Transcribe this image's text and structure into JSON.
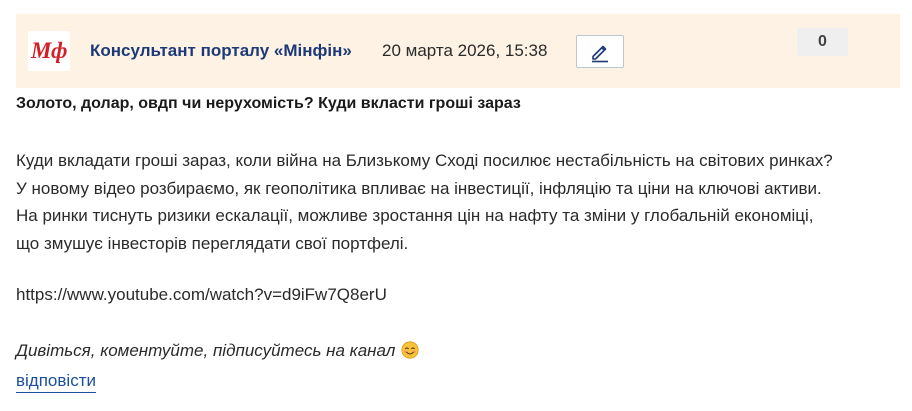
{
  "header": {
    "avatar_text": "Мф",
    "author": "Консультант порталу «Мінфін»",
    "date": "20 марта 2026, 15:38",
    "edit_icon": "pencil-icon",
    "rating": "0"
  },
  "post": {
    "title": "Золото, долар, овдп чи нерухомість? Куди вкласти гроші зараз",
    "body_lines": [
      "Куди вкладати гроші зараз, коли війна на Близькому Сході посилює нестабільність на світових ринках?",
      "У новому відео розбираємо, як геополітика впливає на інвестиції, інфляцію та ціни на ключові активи.",
      "На ринки тиснуть ризики ескалації, можливе зростання цін на нафту та зміни у глобальній економіці,",
      "що змушує інвесторів переглядати свої портфелі."
    ],
    "link": "https://www.youtube.com/watch?v=d9iFw7Q8erU",
    "outro": "Дивіться, коментуйте, підписуйтесь на канал",
    "outro_icon": "smiling-face-emoji-icon",
    "reply_label": "відповісти"
  },
  "colors": {
    "header_bg": "#fdf2e3",
    "author": "#1c3a78",
    "logo": "#d31f26",
    "link": "#1c4fa0"
  }
}
